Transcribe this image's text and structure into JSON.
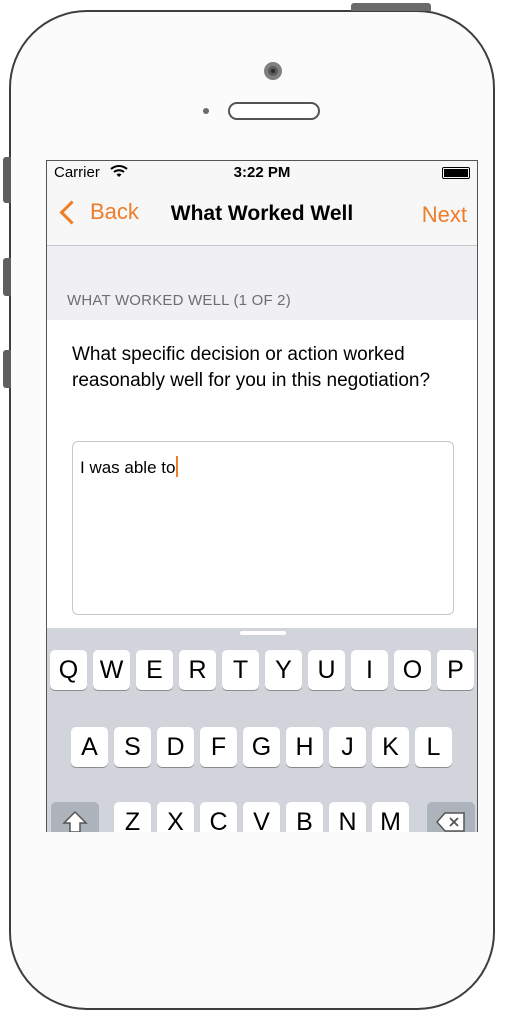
{
  "status_bar": {
    "carrier": "Carrier",
    "time": "3:22 PM"
  },
  "nav": {
    "back_label": "Back",
    "title": "What Worked Well",
    "next_label": "Next"
  },
  "section_header": "WHAT WORKED WELL (1 OF 2)",
  "question": "What specific decision or action worked reasonably well for you in this negotiation?",
  "answer": {
    "value": "I was able to"
  },
  "keyboard": {
    "row1": [
      "Q",
      "W",
      "E",
      "R",
      "T",
      "Y",
      "U",
      "I",
      "O",
      "P"
    ],
    "row2": [
      "A",
      "S",
      "D",
      "F",
      "G",
      "H",
      "J",
      "K",
      "L"
    ],
    "row3": [
      "Z",
      "X",
      "C",
      "V",
      "B",
      "N",
      "M"
    ]
  },
  "colors": {
    "accent": "#ee7d2a",
    "background": "#efeff4",
    "keyboard": "#d1d5db"
  }
}
